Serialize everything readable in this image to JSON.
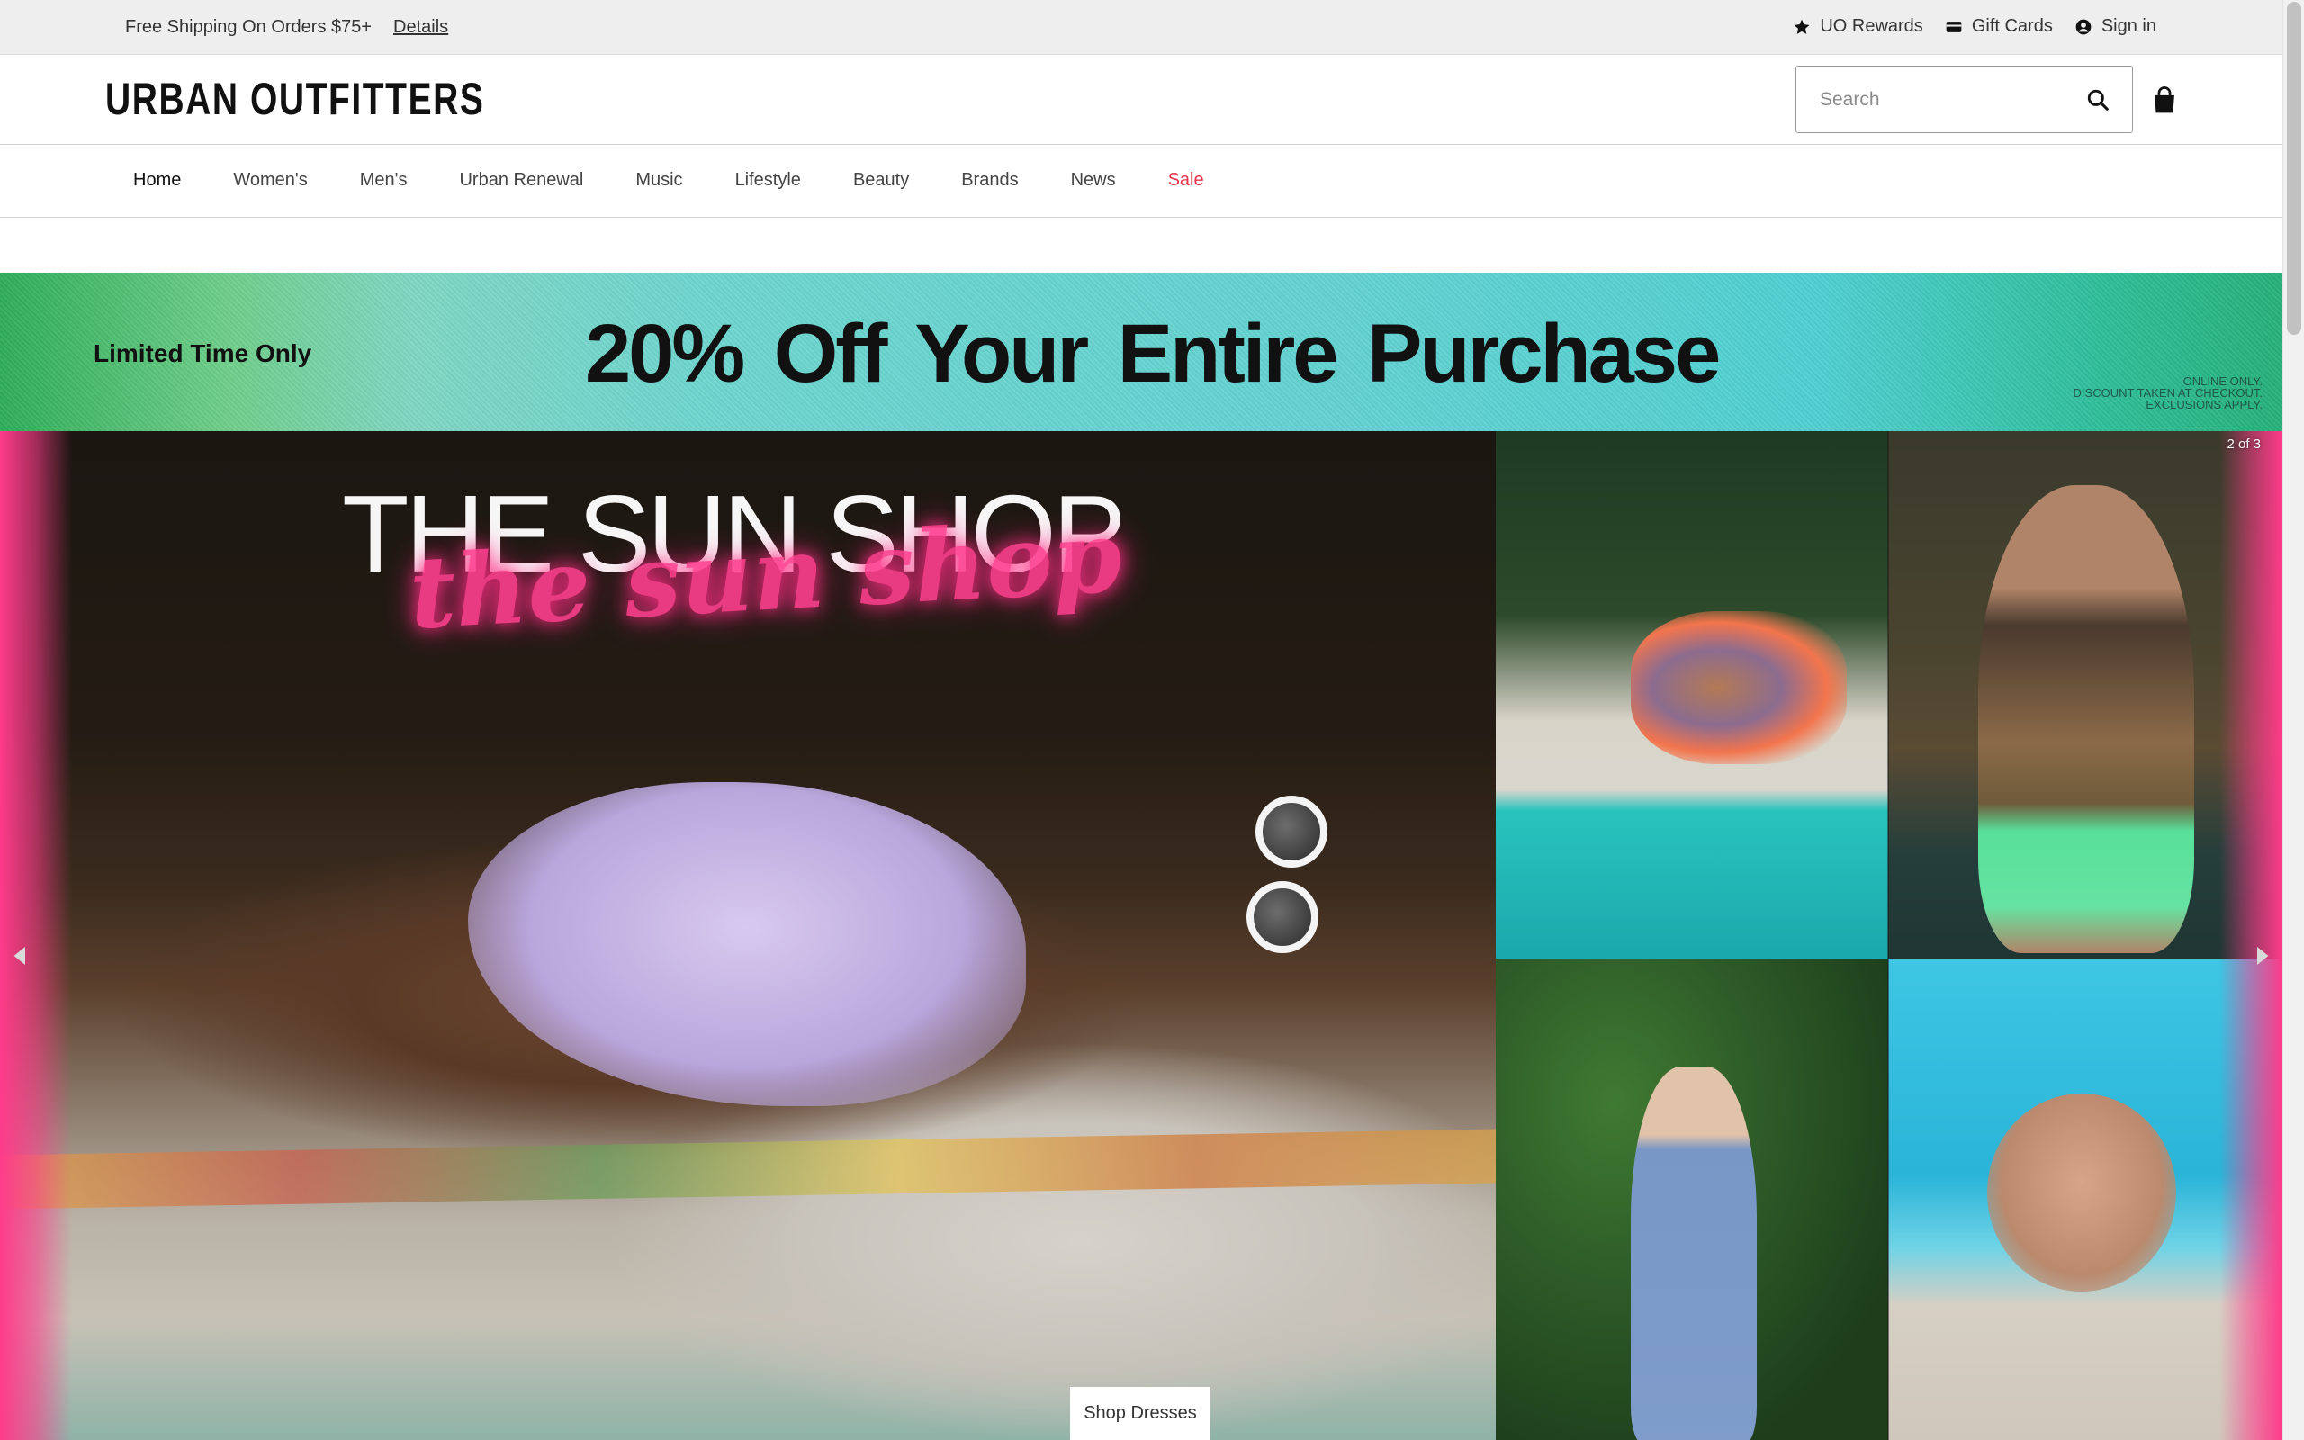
{
  "utility": {
    "shipping_text": "Free Shipping On Orders $75+",
    "details_link": "Details",
    "rewards": "UO Rewards",
    "gift_cards": "Gift Cards",
    "sign_in": "Sign in"
  },
  "header": {
    "logo": "URBAN OUTFITTERS",
    "search_placeholder": "Search"
  },
  "nav": {
    "items": [
      "Home",
      "Women's",
      "Men's",
      "Urban Renewal",
      "Music",
      "Lifestyle",
      "Beauty",
      "Brands",
      "News",
      "Sale"
    ],
    "active": "Home",
    "sale_color": "#e8334a"
  },
  "promo": {
    "left_text": "Limited Time Only",
    "headline": "20% Off Your Entire Purchase",
    "fine_print": [
      "ONLINE ONLY.",
      "DISCOUNT TAKEN AT CHECKOUT.",
      "EXCLUSIONS APPLY."
    ]
  },
  "hero": {
    "title": "THE SUN SHOP",
    "script_title": "the sun shop",
    "slide_counter": "2 of 3",
    "cta": "Shop Dresses",
    "accent_color": "#ff3b8a"
  },
  "icons": {
    "rewards": "star-icon",
    "gift_cards": "card-icon",
    "sign_in": "user-circle-icon",
    "search": "search-icon",
    "bag": "shopping-bag-icon",
    "prev": "chevron-left-icon",
    "next": "chevron-right-icon"
  }
}
